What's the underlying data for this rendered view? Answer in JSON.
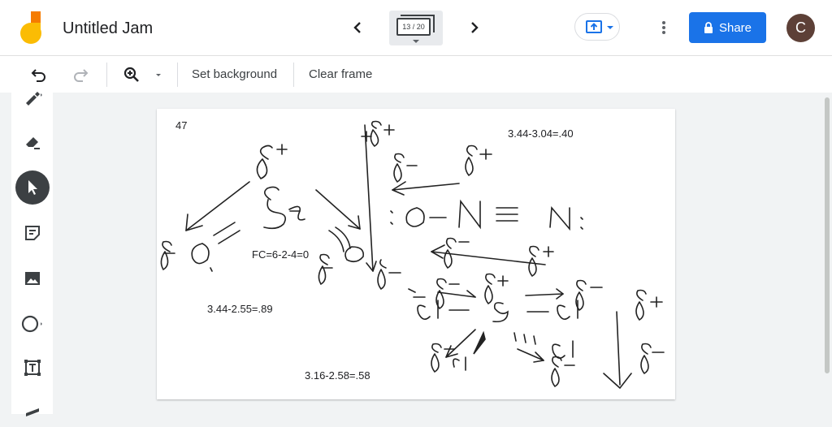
{
  "header": {
    "title": "Untitled Jam",
    "frame_indicator": "13 / 20",
    "share_label": "Share",
    "avatar_initial": "C"
  },
  "toolbar": {
    "set_background_label": "Set background",
    "clear_frame_label": "Clear frame"
  },
  "canvas": {
    "annotations": [
      "47",
      "3.44-3.04=.40",
      "FC=6-2-4=0",
      "3.44-2.55=.89",
      "3.16-2.58=.58"
    ]
  },
  "colors": {
    "share_blue": "#1a73e8",
    "active_tool": "#3c4043",
    "avatar": "#5d4037"
  },
  "icons": {
    "left_tools": [
      "marker-icon",
      "eraser-icon",
      "select-icon",
      "sticky-note-icon",
      "image-icon",
      "circle-icon",
      "text-box-icon",
      "laser-icon"
    ]
  }
}
